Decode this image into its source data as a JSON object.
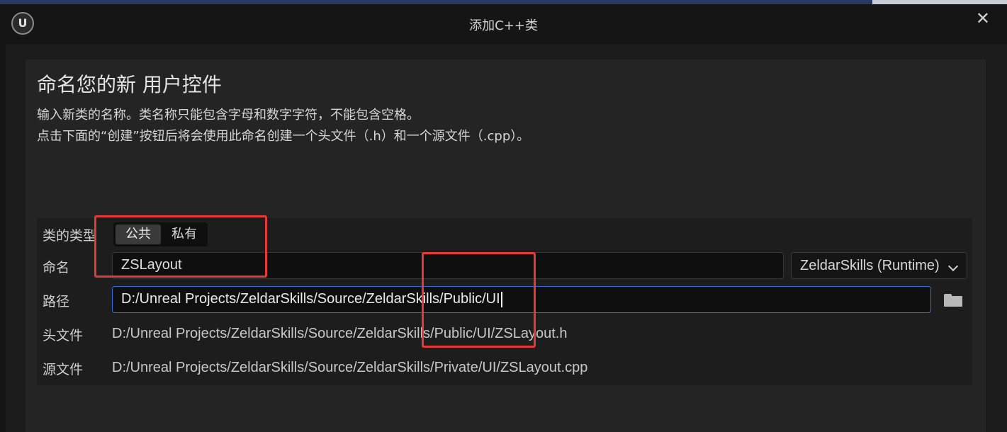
{
  "window": {
    "title": "添加C++类",
    "close_icon": "close-icon",
    "logo_icon": "unreal-logo-icon",
    "logo_text": "U"
  },
  "heading": "命名您的新 用户控件",
  "description": {
    "line1": "输入新类的名称。类名称只能包含字母和数字字符，不能包含空格。",
    "line2": "点击下面的“创建”按钮后将会使用此命名创建一个头文件（.h）和一个源文件（.cpp）。"
  },
  "form": {
    "class_type_label": "类的类型",
    "class_type_options": [
      "公共",
      "私有"
    ],
    "class_type_selected": "公共",
    "name_label": "命名",
    "name_value": "ZSLayout",
    "module_value": "ZeldarSkills (Runtime)",
    "path_label": "路径",
    "path_value": "D:/Unreal Projects/ZeldarSkills/Source/ZeldarSkills/Public/UI",
    "header_label": "头文件",
    "header_value": "D:/Unreal Projects/ZeldarSkills/Source/ZeldarSkills/Public/UI/ZSLayout.h",
    "source_label": "源文件",
    "source_value": "D:/Unreal Projects/ZeldarSkills/Source/ZeldarSkills/Private/UI/ZSLayout.cpp",
    "folder_icon": "folder-icon"
  },
  "colors": {
    "accent": "#2f6fd8",
    "highlight": "#e53935",
    "background": "#151515"
  }
}
